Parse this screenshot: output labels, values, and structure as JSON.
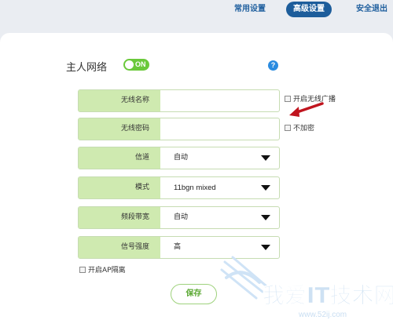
{
  "nav": {
    "common_settings": "常用设置",
    "advanced_settings": "高级设置",
    "logout": "安全退出"
  },
  "section": {
    "title": "主人网络",
    "toggle_label": "ON",
    "toggle_state": "on",
    "help": "?"
  },
  "form": {
    "rows": [
      {
        "label": "无线名称",
        "value": "",
        "type": "text"
      },
      {
        "label": "无线密码",
        "value": "",
        "type": "text"
      },
      {
        "label": "信道",
        "value": "自动",
        "type": "select"
      },
      {
        "label": "模式",
        "value": "11bgn mixed",
        "type": "select"
      },
      {
        "label": "频段带宽",
        "value": "自动",
        "type": "select"
      },
      {
        "label": "信号强度",
        "value": "高",
        "type": "select"
      }
    ],
    "ssid_broadcast_label": "开启无线广播",
    "no_encryption_label": "不加密",
    "ap_isolation_label": "开启AP隔离",
    "save_label": "保存"
  },
  "watermark": {
    "brand": "我爱IT技术网",
    "url": "www.52ij.com"
  },
  "colors": {
    "accent_blue": "#1d5d9b",
    "label_green": "#cfeab0",
    "toggle_green": "#6bc93b",
    "annotation_red": "#c0141e"
  }
}
